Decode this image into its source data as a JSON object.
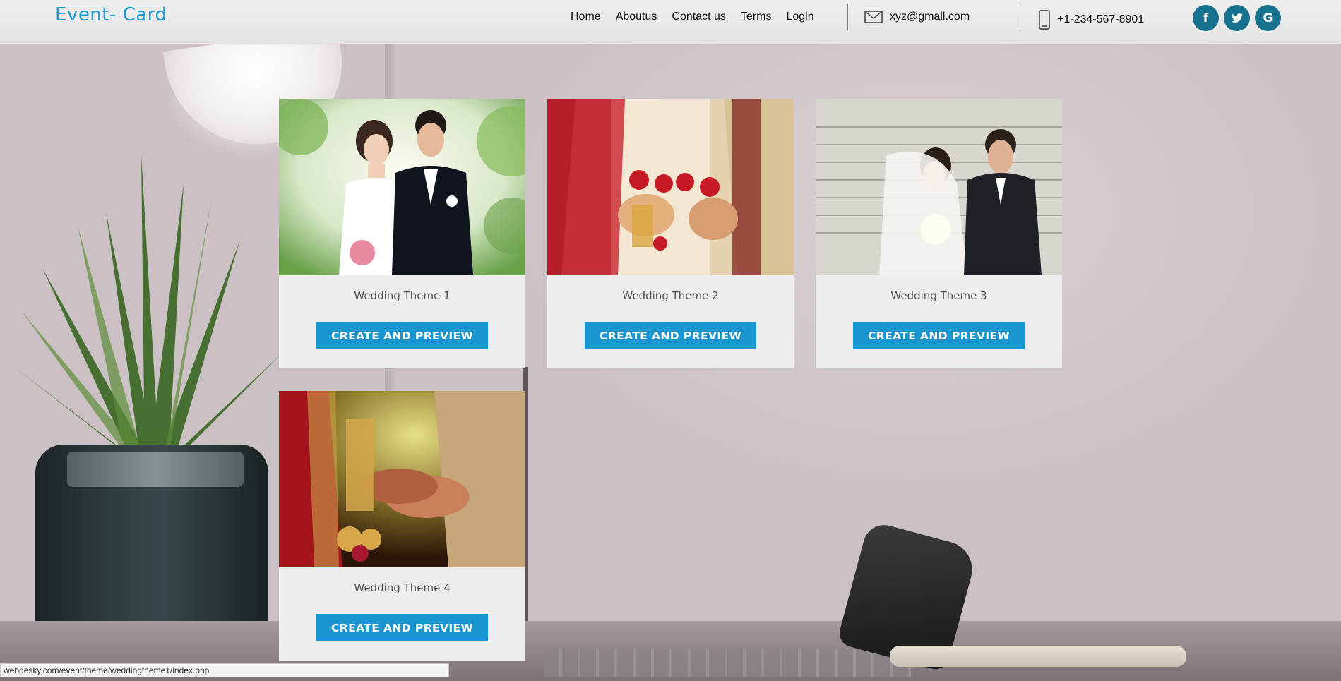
{
  "brand": "Event- Card",
  "nav": {
    "items": [
      "Home",
      "Aboutus",
      "Contact us",
      "Terms",
      "Login"
    ]
  },
  "contact": {
    "email": "xyz@gmail.com",
    "phone": "+1-234-567-8901",
    "email_icon": "mail-icon",
    "phone_icon": "phone-icon"
  },
  "social": [
    {
      "label": "f",
      "icon": "facebook-icon"
    },
    {
      "label": "t",
      "icon": "twitter-icon"
    },
    {
      "label": "G",
      "icon": "google-icon"
    }
  ],
  "cards": [
    {
      "title": "Wedding Theme 1",
      "button": "CREATE AND PREVIEW"
    },
    {
      "title": "Wedding Theme 2",
      "button": "CREATE AND PREVIEW"
    },
    {
      "title": "Wedding Theme 3",
      "button": "CREATE AND PREVIEW"
    },
    {
      "title": "Wedding Theme 4",
      "button": "CREATE AND PREVIEW"
    }
  ],
  "status_url": "webdesky.com/event/theme/weddingtheme1/index.php",
  "colors": {
    "brand": "#1b98d0",
    "button": "#1996cf",
    "social": "#17728f"
  }
}
